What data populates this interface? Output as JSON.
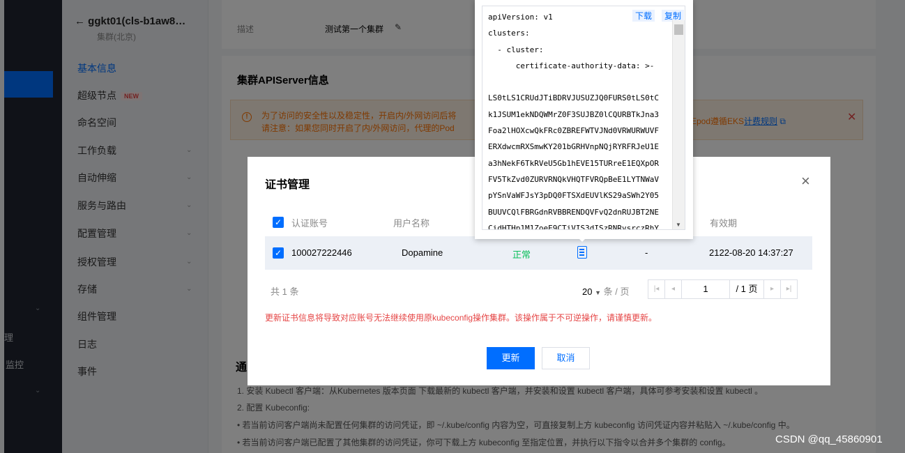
{
  "sidebar": {
    "items": [
      {
        "label": "理"
      },
      {
        "label": "监控"
      }
    ]
  },
  "subnav": {
    "cluster_title": "ggkt01(cls-b1aw8…",
    "region": "集群(北京)",
    "items": [
      {
        "label": "基本信息"
      },
      {
        "label": "超级节点",
        "badge": "NEW"
      },
      {
        "label": "命名空间"
      },
      {
        "label": "工作负载"
      },
      {
        "label": "自动伸缩"
      },
      {
        "label": "服务与路由"
      },
      {
        "label": "配置管理"
      },
      {
        "label": "授权管理"
      },
      {
        "label": "存储"
      },
      {
        "label": "组件管理"
      },
      {
        "label": "日志"
      },
      {
        "label": "事件"
      }
    ]
  },
  "main": {
    "desc_label": "描述",
    "desc_value": "测试第一个集群",
    "apiserver_title": "集群APIServer信息",
    "warning_line1": "为了访问的安全性以及稳定性，开启内/外网访问后将",
    "warning_line2": "请注意：如果您同时开启了内/外网访问，代理的Pod",
    "warning_right": "Epod遵循EKS",
    "warning_link": "计费规则",
    "section_left": "通",
    "list": [
      "1. 安装 Kubectl 客户端：从Kubernetes 版本页面 下载最新的 kubectl 客户端，并安装和设置 kubectl 客户端，具体可参考安装和设置 kubectl 。",
      "2. 配置 Kubeconfig:",
      "• 若当前访问客户端尚未配置任何集群的访问凭证，即 ~/.kube/config 内容为空，可直接复制上方 kubeconfig 访问凭证内容并粘贴入 ~/.kube/config 中。",
      "• 若当前访问客户端已配置了其他集群的访问凭证，你可下载上方 kubeconfig 至指定位置，并执行以下指令以合并多个集群的 config。"
    ]
  },
  "modal": {
    "title": "证书管理",
    "columns": [
      "认证账号",
      "用户名称",
      "有效期"
    ],
    "row": {
      "account": "100027222446",
      "username": "Dopamine",
      "status": "正常",
      "dash": "-",
      "expiry": "2122-08-20 14:37:27"
    },
    "pager": {
      "total": "共 1 条",
      "page_size": "20",
      "page_size_unit": "条 / 页",
      "current_page": "1",
      "page_total": "/ 1 页"
    },
    "warning": "更新证书信息将导致对应账号无法继续使用原kubeconfig操作集群。该操作属于不可逆操作，请谨慎更新。",
    "update_label": "更新",
    "cancel_label": "取消"
  },
  "popover": {
    "download_label": "下载",
    "copy_label": "复制",
    "code": "apiVersion: v1\nclusters:\n  - cluster:\n      certificate-authority-data: >-\n\nLS0tLS1CRUdJTiBDRVJUSUZJQ0FURS0tLS0tC\nk1JSUM1ekNDQWMrZ0F3SUJBZ0lCQURBTkJna3\nFoa2lHOXcwQkFRc0ZBREFWTVJNd0VRWURWUVF\nERXdwcmRXSmwKY201bGRHVnpNQjRYRFRJeU1E\na3hNekF6TkRVeU5Gb1hEVE15TURreE1EQXpOR\nFV5TkZvd0ZURVRNQkVHQTFVRQpBeE1LYTNWaV\npYSnVaWFJsY3pDQ0FTSXdEUVlKS29aSWh2Y05\nBUUVCQlFBRGdnRVBBRENDQVFvQ2dnRUJBT2NE\nCidHTHp1M1ZoeE9CTiVIS3dISzRNRvsrczRhY"
  },
  "watermark": "CSDN @qq_45860901"
}
